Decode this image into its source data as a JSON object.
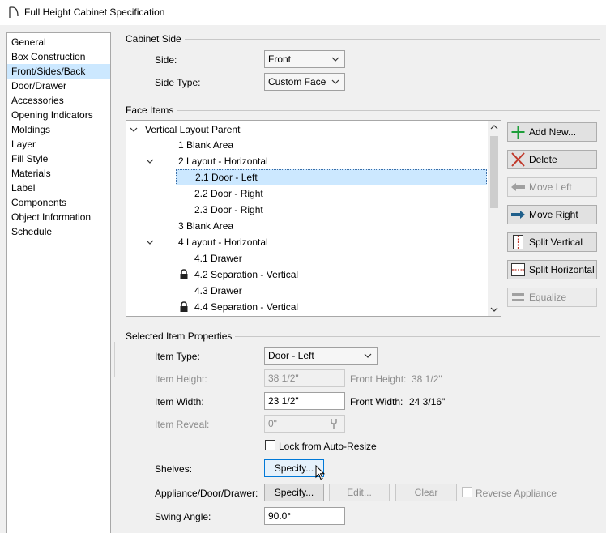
{
  "window": {
    "title": "Full Height Cabinet Specification"
  },
  "nav": {
    "items": [
      {
        "label": "General"
      },
      {
        "label": "Box Construction"
      },
      {
        "label": "Front/Sides/Back",
        "selected": true
      },
      {
        "label": "Door/Drawer"
      },
      {
        "label": "Accessories"
      },
      {
        "label": "Opening Indicators"
      },
      {
        "label": "Moldings"
      },
      {
        "label": "Layer"
      },
      {
        "label": "Fill Style"
      },
      {
        "label": "Materials"
      },
      {
        "label": "Label"
      },
      {
        "label": "Components"
      },
      {
        "label": "Object Information"
      },
      {
        "label": "Schedule"
      }
    ]
  },
  "cabinet_side": {
    "title": "Cabinet Side",
    "side_label": "Side:",
    "side_value": "Front",
    "side_type_label": "Side Type:",
    "side_type_value": "Custom Face"
  },
  "face_items": {
    "title": "Face Items",
    "tree": [
      {
        "label": "Vertical Layout Parent",
        "expanded": true
      },
      {
        "label": "1 Blank Area"
      },
      {
        "label": "2 Layout - Horizontal",
        "expanded": true
      },
      {
        "label": "2.1 Door - Left",
        "selected": true
      },
      {
        "label": "2.2 Door - Right"
      },
      {
        "label": "2.3 Door - Right"
      },
      {
        "label": "3 Blank Area"
      },
      {
        "label": "4 Layout - Horizontal",
        "expanded": true
      },
      {
        "label": "4.1 Drawer"
      },
      {
        "label": "4.2 Separation - Vertical",
        "locked": true
      },
      {
        "label": "4.3 Drawer"
      },
      {
        "label": "4.4 Separation - Vertical",
        "locked": true
      }
    ],
    "buttons": {
      "add_new": "Add New...",
      "delete": "Delete",
      "move_left": "Move Left",
      "move_right": "Move Right",
      "split_vertical": "Split Vertical",
      "split_horizontal": "Split Horizontal",
      "equalize": "Equalize"
    },
    "colors": {
      "add": "#1e9e3a",
      "delete": "#c0392b",
      "move_right": "#1f5f8b",
      "split": "#c0392b"
    }
  },
  "selected_item": {
    "title": "Selected Item Properties",
    "item_type_label": "Item Type:",
    "item_type_value": "Door - Left",
    "item_height_label": "Item Height:",
    "item_height_value": "38 1/2\"",
    "front_height_label": "Front Height:",
    "front_height_value": "38 1/2\"",
    "item_width_label": "Item Width:",
    "item_width_value": "23 1/2\"",
    "front_width_label": "Front Width:",
    "front_width_value": "24 3/16\"",
    "item_reveal_label": "Item Reveal:",
    "item_reveal_value": "0\"",
    "lock_label": "Lock from Auto-Resize",
    "shelves_label": "Shelves:",
    "shelves_button": "Specify...",
    "appliance_label": "Appliance/Door/Drawer:",
    "appliance_specify": "Specify...",
    "appliance_edit": "Edit...",
    "appliance_clear": "Clear",
    "reverse_label": "Reverse Appliance",
    "swing_label": "Swing Angle:",
    "swing_value": "90.0°"
  }
}
